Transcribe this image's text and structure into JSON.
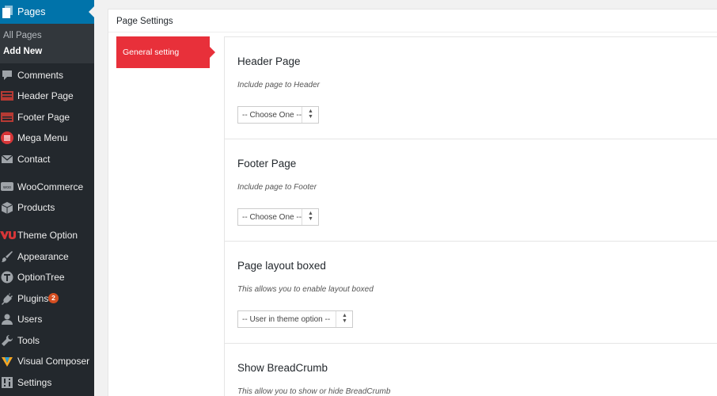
{
  "sidebar": {
    "current": "Pages",
    "submenu": [
      "All Pages",
      "Add New"
    ],
    "items": [
      {
        "label": "Comments",
        "icon": "comment-icon"
      },
      {
        "label": "Header Page",
        "icon": "header-page-icon"
      },
      {
        "label": "Footer Page",
        "icon": "footer-page-icon"
      },
      {
        "label": "Mega Menu",
        "icon": "mega-menu-icon"
      },
      {
        "label": "Contact",
        "icon": "mail-icon"
      },
      {
        "label": "WooCommerce",
        "icon": "woocommerce-icon"
      },
      {
        "label": "Products",
        "icon": "box-icon"
      },
      {
        "label": "Theme Option",
        "icon": "theme-logo-icon"
      },
      {
        "label": "Appearance",
        "icon": "brush-icon"
      },
      {
        "label": "OptionTree",
        "icon": "optiontree-icon"
      },
      {
        "label": "Plugins",
        "icon": "plug-icon",
        "badge": "2"
      },
      {
        "label": "Users",
        "icon": "users-icon"
      },
      {
        "label": "Tools",
        "icon": "wrench-icon"
      },
      {
        "label": "Visual Composer",
        "icon": "visual-composer-icon"
      },
      {
        "label": "Settings",
        "icon": "settings-icon"
      }
    ]
  },
  "metabox": {
    "title": "Page Settings",
    "tab": "General setting",
    "sections": [
      {
        "title": "Header Page",
        "desc": "Include page to Header",
        "select": "-- Choose One --"
      },
      {
        "title": "Footer Page",
        "desc": "Include page to Footer",
        "select": "-- Choose One --"
      },
      {
        "title": "Page layout boxed",
        "desc": "This allows you to enable layout boxed",
        "select": "-- User in theme option --"
      },
      {
        "title": "Show BreadCrumb",
        "desc": "This allow you to show or hide BreadCrumb"
      }
    ]
  },
  "colors": {
    "sidebar_bg": "#23282d",
    "active_blue": "#0073aa",
    "tab_red": "#e8303a",
    "badge_orange": "#d54e21"
  }
}
